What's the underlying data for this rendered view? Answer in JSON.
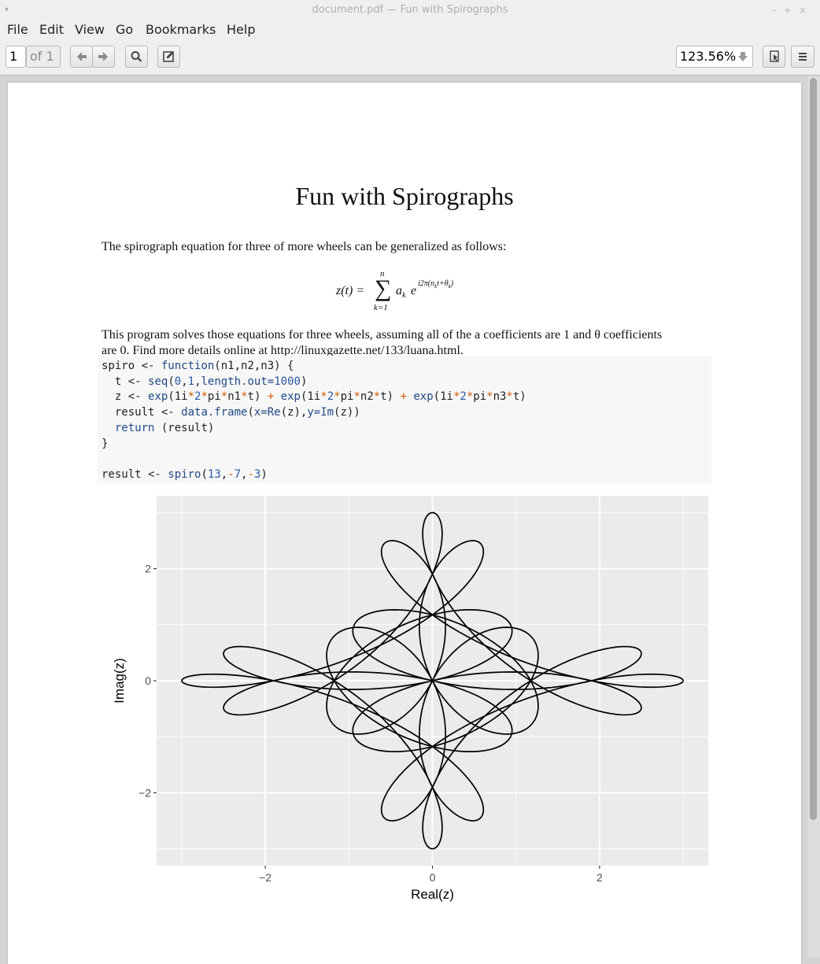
{
  "window": {
    "title": "document.pdf — Fun with Spirographs",
    "controls": [
      "–",
      "+",
      "×"
    ]
  },
  "menu": [
    "File",
    "Edit",
    "View",
    "Go",
    "Bookmarks",
    "Help"
  ],
  "toolbar": {
    "page_value": "1",
    "page_of": "of 1",
    "zoom": "123.56%"
  },
  "document": {
    "title": "Fun with Spirographs",
    "intro": "The spirograph equation for three of more wheels can be generalized as follows:",
    "equation": {
      "lhs": "z(t) =",
      "sum_upper": "n",
      "sum_lower": "k=1",
      "term": "a",
      "term_sub": "k",
      "base": "e",
      "exponent": "i2π(n",
      "exp_sub1": "k",
      "exp_mid": "t+θ",
      "exp_sub2": "k",
      "exp_end": ")"
    },
    "para2_line1": "This program solves those equations for three wheels, assuming all of the a coefficients are 1 and θ coefficients",
    "para2_line2": "are 0. Find more details online at http://linuxgazette.net/133/luana.html.",
    "code_lines": [
      "spiro <- function(n1,n2,n3) {",
      "  t <- seq(0,1,length.out=1000)",
      "  z <- exp(1i*2*pi*n1*t) + exp(1i*2*pi*n2*t) + exp(1i*2*pi*n3*t)",
      "  result <- data.frame(x=Re(z),y=Im(z))",
      "  return (result)",
      "}",
      "",
      "result <- spiro(13,-7,-3)"
    ]
  },
  "chart_data": {
    "type": "line",
    "parametric": "z(t) = exp(i2π·13t) + exp(i2π·(−7)t) + exp(i2π·(−3)t)",
    "wheels": [
      13,
      -7,
      -3
    ],
    "t_range": [
      0,
      1
    ],
    "n_points": 1000,
    "xlabel": "Real(z)",
    "ylabel": "Imag(z)",
    "x_ticks": [
      -2,
      0,
      2
    ],
    "y_ticks": [
      -2,
      0,
      2
    ],
    "x_tick_labels": [
      "−2",
      "0",
      "2"
    ],
    "y_tick_labels": [
      "−2",
      "0",
      "2"
    ],
    "xlim": [
      -3.3,
      3.3
    ],
    "ylim": [
      -3.3,
      3.3
    ],
    "grid": true,
    "panel_color": "#ebebeb",
    "line_color": "#000000"
  }
}
